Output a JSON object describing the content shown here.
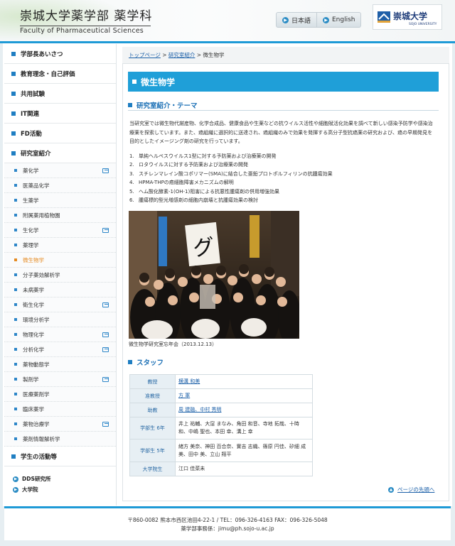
{
  "header": {
    "title": "崇城大学薬学部 薬学科",
    "subtitle": "Faculty of Pharmaceutical Sciences",
    "lang_ja": "日本語",
    "lang_en": "English",
    "logo_name": "崇城大学",
    "logo_en": "SOJO UNIVERSITY",
    "accent_color": "#1e9ad6",
    "icons": {
      "lang": "arrow-right-circle-icon",
      "external": "external-window-icon"
    }
  },
  "sidebar": {
    "main_items": [
      {
        "label": "学部長あいさつ"
      },
      {
        "label": "教育理念・自己評価"
      },
      {
        "label": "共用試験"
      },
      {
        "label": "IT関連"
      },
      {
        "label": "FD活動"
      },
      {
        "label": "研究室紹介"
      }
    ],
    "sub_items": [
      {
        "label": "薬化学",
        "external": true
      },
      {
        "label": "医薬品化学",
        "external": false
      },
      {
        "label": "生薬学",
        "external": false
      },
      {
        "label": "附属薬用植物園",
        "external": false
      },
      {
        "label": "生化学",
        "external": true
      },
      {
        "label": "薬理学",
        "external": false
      },
      {
        "label": "微生物学",
        "external": false,
        "active": true
      },
      {
        "label": "分子薬効解析学",
        "external": false
      },
      {
        "label": "未病薬学",
        "external": false
      },
      {
        "label": "衛生化学",
        "external": true
      },
      {
        "label": "環境分析学",
        "external": false
      },
      {
        "label": "物理化学",
        "external": true
      },
      {
        "label": "分析化学",
        "external": true
      },
      {
        "label": "薬物動態学",
        "external": false
      },
      {
        "label": "製剤学",
        "external": true
      },
      {
        "label": "医療薬剤学",
        "external": false
      },
      {
        "label": "臨床薬学",
        "external": false
      },
      {
        "label": "薬物治療学",
        "external": true
      },
      {
        "label": "薬剤情報解析学",
        "external": false
      }
    ],
    "student_item": {
      "label": "学生の活動等"
    },
    "foot_links": [
      {
        "label": "DDS研究所"
      },
      {
        "label": "大学院"
      }
    ]
  },
  "breadcrumb": {
    "home": "トップページ",
    "sep1": " > ",
    "parent": "研究室紹介",
    "sep2": " > ",
    "current": "微生物学"
  },
  "main": {
    "title": "微生物学",
    "section1_heading": "研究室紹介・テーマ",
    "intro": "当研究室では微生物代謝産物、化学合成品、健康食品や生薬などの抗ウイルス活性や細胞賦活化効果を調べて新しい感染予防学や感染治療薬を探索しています。また、癌組織に選択的に送達され、癌組織のみで効果を発揮する高分子型抗癌薬の研究および、癌の早期発見を目的としたイメージング剤の研究を行っています。",
    "themes": [
      {
        "num": "1.",
        "text": "単純ヘルペスウイルス1型に対する予防薬および治療薬の開発"
      },
      {
        "num": "2.",
        "text": "ロタウイルスに対する予防薬および治療薬の開発"
      },
      {
        "num": "3.",
        "text": "スチレンマレイン酸コポリマー(SMA)に結合した亜鉛プロトポルフィリンの抗腫瘍効果"
      },
      {
        "num": "4.",
        "text": "HPMA-THPの癌細胞障害メカニズムの解明"
      },
      {
        "num": "5.",
        "text": "ヘム酸化酵素-1(OH-1)阻害による抗悪性腫瘍剤の併用増強効果"
      },
      {
        "num": "6.",
        "text": "腫瘍標的型光増感剤の細胞内崩壊と抗腫瘍効果の検討"
      }
    ],
    "photo_sign": "グ",
    "photo_caption": "微生物学研究室忘年会（2013.12.13）",
    "section2_heading": "スタッフ",
    "staff": [
      {
        "role": "教授",
        "names": "横溝 和美",
        "link": true
      },
      {
        "role": "准教授",
        "names": "方 軍",
        "link": true
      },
      {
        "role": "助教",
        "names": "周 建融、中村 秀明",
        "link": true
      },
      {
        "role": "学部生 6年",
        "names": "井上 祐輔、大窪 まなみ、角田 和音、寺地 拓哉、十時 和、中嶋 聖也、本田 幸、溝上 幸",
        "link": false
      },
      {
        "role": "学部生 5年",
        "names": "緒方 美奈、神田 百合奈、實吉 志織、篠原 円佳、矽細 成美、田中 美、立山 翔平",
        "link": false
      },
      {
        "role": "大学院生",
        "names": "江口 佳菜未",
        "link": false
      }
    ],
    "back_link": "ページの先頭へ"
  },
  "footer": {
    "address": "〒860-0082 熊本市西区池田4-22-1 / TEL：096-326-4163 FAX：096-326-5048",
    "office": "薬学部事務係：jimu@ph.sojo-u.ac.jp"
  }
}
